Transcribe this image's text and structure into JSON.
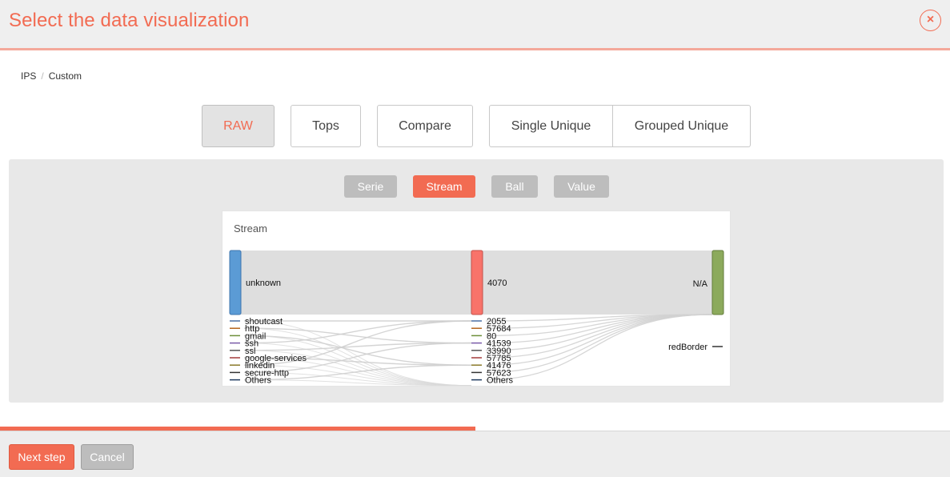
{
  "header": {
    "title": "Select the data visualization",
    "close_label": "×"
  },
  "breadcrumb": [
    "IPS",
    "Custom"
  ],
  "modes": [
    {
      "label": "RAW",
      "active": true
    },
    {
      "label": "Tops",
      "active": false
    },
    {
      "label": "Compare",
      "active": false
    },
    {
      "label": "Single Unique",
      "active": false
    },
    {
      "label": "Grouped Unique",
      "active": false
    }
  ],
  "viz_types": [
    {
      "label": "Serie",
      "active": false
    },
    {
      "label": "Stream",
      "active": true
    },
    {
      "label": "Ball",
      "active": false
    },
    {
      "label": "Value",
      "active": false
    }
  ],
  "chart": {
    "title": "Stream",
    "colors": {
      "node1": "#5b9bd5",
      "node2": "#f8736a",
      "node3": "#8caa5c",
      "link": "#d8d8d8"
    }
  },
  "chart_data": {
    "type": "sankey",
    "columns": [
      {
        "main": "unknown",
        "others": [
          "shoutcast",
          "http",
          "gmail",
          "ssh",
          "ssl",
          "google-services",
          "linkedin",
          "secure-http",
          "Others"
        ]
      },
      {
        "main": "4070",
        "others": [
          "2055",
          "57684",
          "80",
          "41539",
          "33990",
          "57785",
          "41476",
          "57623",
          "Others"
        ]
      },
      {
        "main": "N/A",
        "others": [
          "redBorder"
        ]
      }
    ]
  },
  "progress": {
    "fraction": 0.5
  },
  "footer": {
    "next_label": "Next step",
    "cancel_label": "Cancel"
  }
}
